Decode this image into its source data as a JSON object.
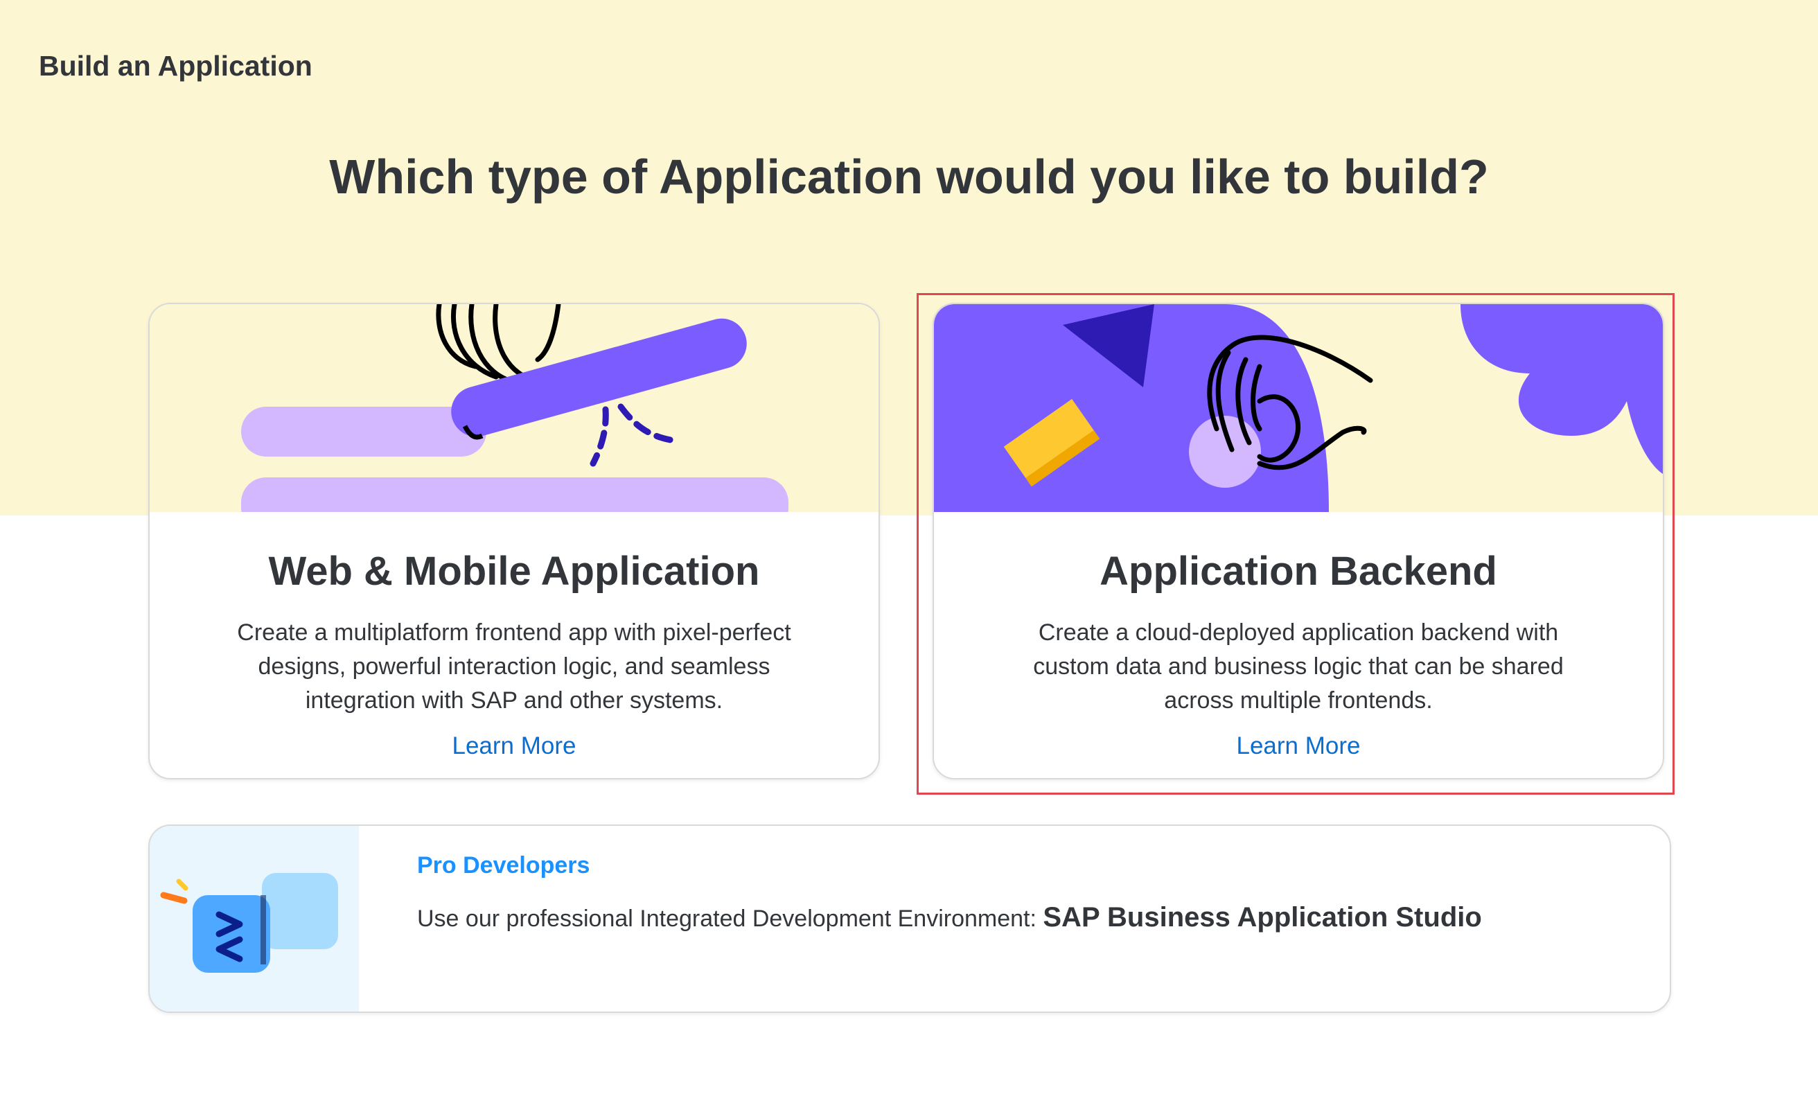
{
  "page": {
    "title": "Build an Application"
  },
  "headline": "Which type of Application would you like to build?",
  "cards": [
    {
      "title": "Web & Mobile Application",
      "description": "Create a multiplatform frontend app with pixel-perfect designs, powerful interaction logic, and seamless integration with SAP and other systems.",
      "link": "Learn More"
    },
    {
      "title": "Application Backend",
      "description": "Create a cloud-deployed application backend with custom data and business logic that can be shared across multiple frontends.",
      "link": "Learn More",
      "selected": true
    }
  ],
  "pro": {
    "title": "Pro Developers",
    "description": "Use our professional Integrated Development Environment: ",
    "product": "SAP Business Application Studio"
  },
  "colors": {
    "band": "#fdf6d3",
    "accent_purple": "#7b5cff",
    "link": "#0a6ed1",
    "pro_link": "#1b90ff",
    "selection": "#e0474f"
  },
  "icons": {
    "web_card": "hand-with-bar-illustration",
    "backend_card": "hand-with-shapes-illustration",
    "pro": "code-bubble-icon"
  }
}
